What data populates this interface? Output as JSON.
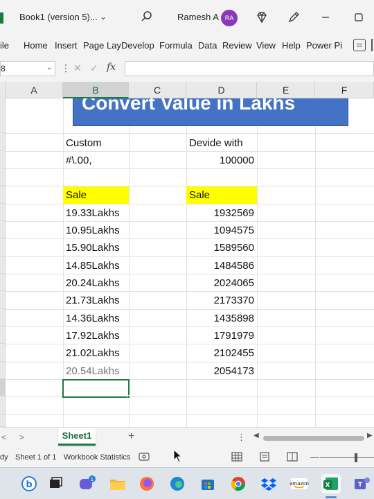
{
  "titlebar": {
    "doc_title": "Book1 (version 5)...",
    "user_name": "Ramesh A",
    "avatar_initials": "RA"
  },
  "ribbon": {
    "tabs": [
      "ile",
      "Home",
      "Insert",
      "Page Lay",
      "Develop",
      "Formula",
      "Data",
      "Review",
      "View",
      "Help",
      "Power Pi"
    ]
  },
  "formula_bar": {
    "name_box": "8",
    "formula": ""
  },
  "columns": [
    "A",
    "B",
    "C",
    "D",
    "E",
    "F"
  ],
  "sheet": {
    "banner_text": "Convert Value in Lakhs",
    "custom_label": "Custom",
    "custom_format": "#\\.00,",
    "divide_label": "Devide with",
    "divide_value": "100000",
    "sale_header_b": "Sale",
    "sale_header_d": "Sale",
    "lakhs": [
      "19.33Lakhs",
      "10.95Lakhs",
      "15.90Lakhs",
      "14.85Lakhs",
      "20.24Lakhs",
      "21.73Lakhs",
      "14.36Lakhs",
      "17.92Lakhs",
      "21.02Lakhs",
      "20.54Lakhs"
    ],
    "sales": [
      "1932569",
      "1094575",
      "1589560",
      "1484586",
      "2024065",
      "2173370",
      "1435898",
      "1791979",
      "2102455",
      "2054173"
    ]
  },
  "sheet_tabs": {
    "active": "Sheet1"
  },
  "statusbar": {
    "ready": "dy",
    "sheet_pos": "Sheet 1 of 1",
    "workbook_stats": "Workbook Statistics"
  },
  "colors": {
    "excel_green": "#1d7a43",
    "banner_blue": "#4472c4",
    "highlight_yellow": "#ffff00",
    "avatar_purple": "#8a3ab9"
  }
}
